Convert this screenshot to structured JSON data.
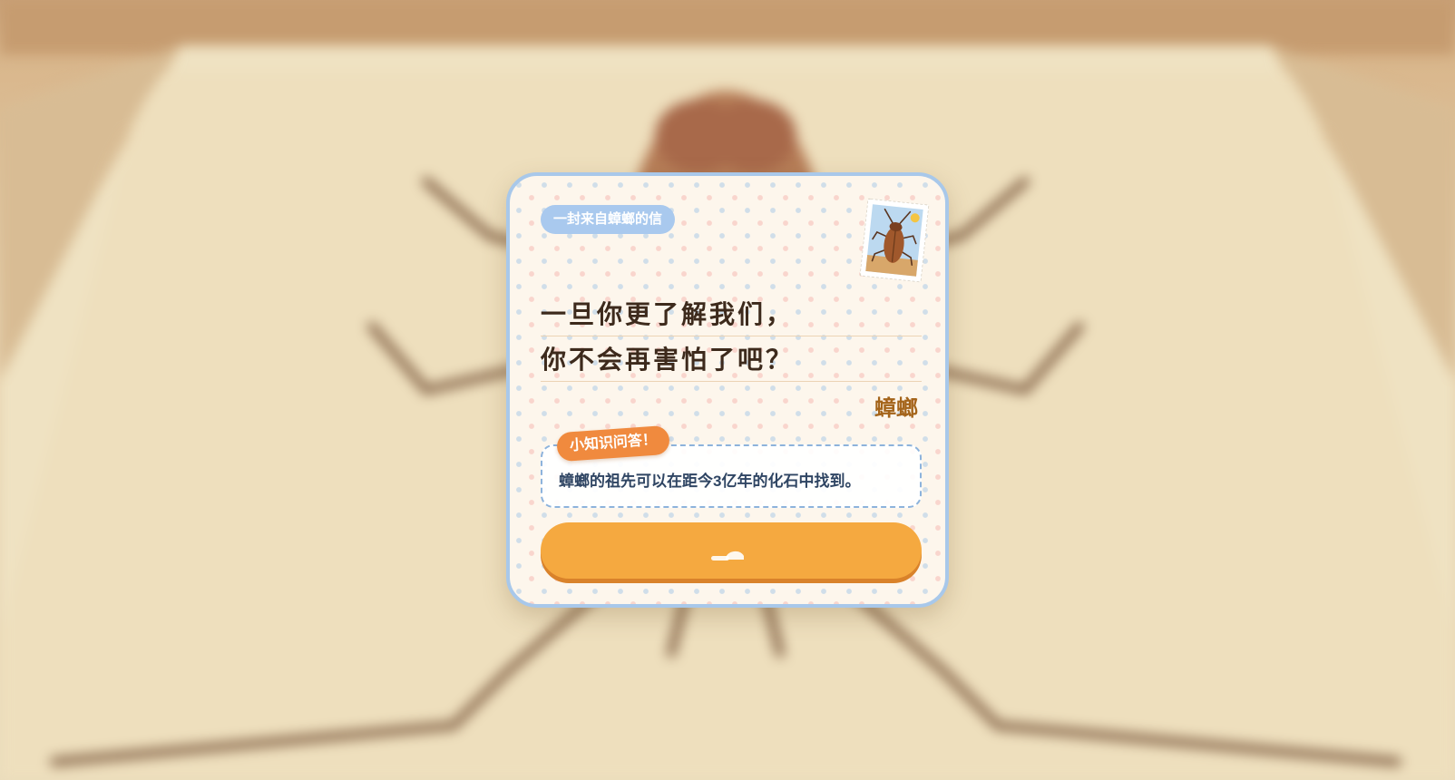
{
  "letter": {
    "tag": "一封来自蟑螂的信",
    "lines": [
      "一旦你更了解我们，",
      "你不会再害怕了吧？"
    ],
    "signature": "蟑螂"
  },
  "stamp": {
    "icon": "cockroach-stamp-icon"
  },
  "quiz": {
    "label": "小知识问答！",
    "text": "蟑螂的祖先可以在距今3亿年的化石中找到。"
  },
  "button": {
    "label": ""
  },
  "colors": {
    "card_border": "#a8c8ea",
    "tag_bg": "#a9c9ee",
    "quiz_tag_bg": "#f08a3e",
    "button_bg": "#f5a940",
    "signature": "#a4641a"
  }
}
